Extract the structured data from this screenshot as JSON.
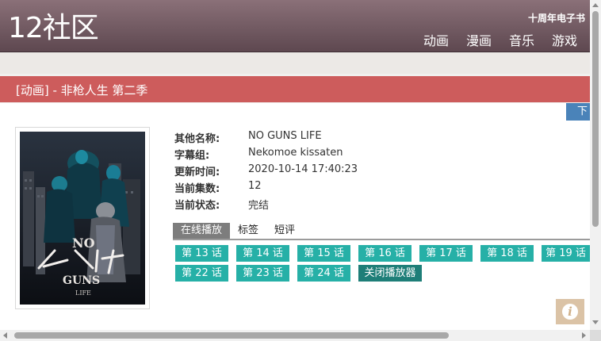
{
  "header": {
    "logo": "12社区",
    "subtitle": "十周年电子书",
    "nav": [
      "动画",
      "漫画",
      "音乐",
      "游戏"
    ]
  },
  "title_bar": {
    "text": "[动画] - 非枪人生 第二季"
  },
  "download_button": {
    "label": "下"
  },
  "poster": {
    "alt_text": "NO GUNS LIFE"
  },
  "info": {
    "rows": [
      {
        "key": "其他名称:",
        "value": "NO GUNS LIFE"
      },
      {
        "key": "字幕组:",
        "value": "Nekomoe kissaten"
      },
      {
        "key": "更新时间:",
        "value": "2020-10-14 17:40:23"
      },
      {
        "key": "当前集数:",
        "value": "12"
      },
      {
        "key": "当前状态:",
        "value": "完结"
      }
    ]
  },
  "tabs": [
    {
      "label": "在线播放",
      "active": true
    },
    {
      "label": "标签",
      "active": false
    },
    {
      "label": "短评",
      "active": false
    }
  ],
  "episodes": [
    "第 13 话",
    "第 14 话",
    "第 15 话",
    "第 16 话",
    "第 17 话",
    "第 18 话",
    "第 19 话",
    "第 22 话",
    "第 23 话",
    "第 24 话"
  ],
  "close_player": "关闭播放器",
  "colors": {
    "header": "#6f5860",
    "title_bar": "#cd5c5c",
    "episode_button": "#26b0a7",
    "close_button": "#1e7e78",
    "download_button": "#4a83b9",
    "active_tab": "#7d7d7d"
  },
  "icons": {
    "info_badge": "info-icon"
  }
}
